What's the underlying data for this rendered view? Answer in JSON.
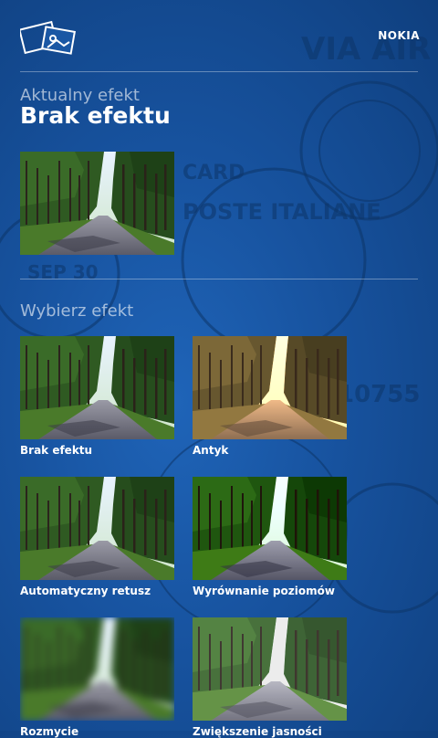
{
  "header": {
    "brand": "NOKIA",
    "app_icon": "postcard-icon"
  },
  "current": {
    "label": "Aktualny efekt",
    "title": "Brak efektu"
  },
  "choose": {
    "label": "Wybierz efekt",
    "effects": [
      {
        "name": "Brak efektu",
        "style": "normal"
      },
      {
        "name": "Antyk",
        "style": "antique"
      },
      {
        "name": "Automatyczny retusz",
        "style": "normal"
      },
      {
        "name": "Wyrównanie poziomów",
        "style": "levels"
      },
      {
        "name": "Rozmycie",
        "style": "blur"
      },
      {
        "name": "Zwiększenie jasności",
        "style": "bright"
      }
    ]
  },
  "stamp_text": {
    "via": "VIA AIR",
    "poste": "POSTE ITALIANE",
    "number": "10755",
    "date": "SEP 30",
    "card": "CARD"
  }
}
